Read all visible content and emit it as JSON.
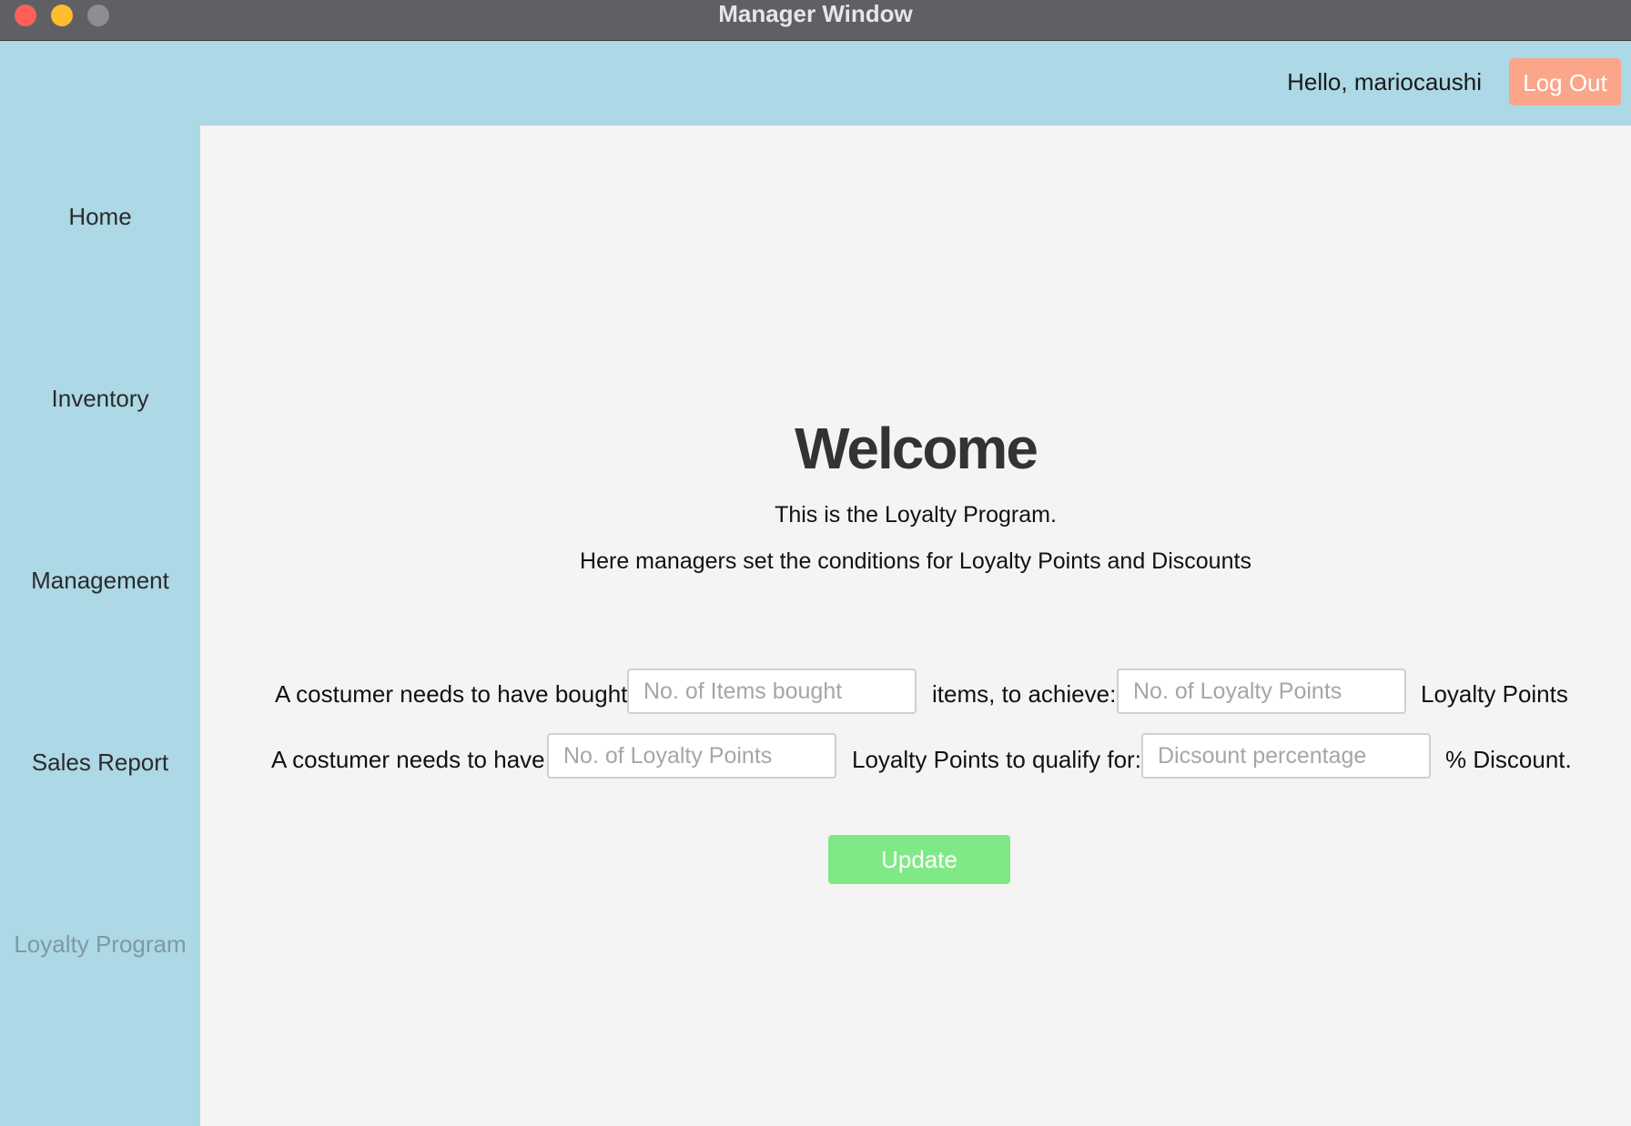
{
  "window": {
    "title": "Manager Window"
  },
  "header": {
    "greeting": "Hello, mariocaushi",
    "logout_label": "Log Out"
  },
  "sidebar": {
    "items": [
      {
        "label": "Home",
        "active": false
      },
      {
        "label": "Inventory",
        "active": false
      },
      {
        "label": "Management",
        "active": false
      },
      {
        "label": "Sales Report",
        "active": false
      },
      {
        "label": "Loyalty Program",
        "active": true
      }
    ]
  },
  "main": {
    "heading": "Welcome",
    "subtitle_1": "This is the Loyalty Program.",
    "subtitle_2": "Here managers set the conditions for Loyalty Points and Discounts",
    "row1": {
      "label_before": "A costumer needs to have bought:",
      "items_field": {
        "value": "",
        "placeholder": "No. of Items bought"
      },
      "label_middle": "items, to achieve:",
      "points_field": {
        "value": "",
        "placeholder": "No. of Loyalty Points"
      },
      "label_after": "Loyalty Points"
    },
    "row2": {
      "label_before": "A costumer needs to have:",
      "points_field": {
        "value": "",
        "placeholder": "No. of Loyalty Points"
      },
      "label_middle": "Loyalty Points to qualify for:",
      "discount_field": {
        "value": "",
        "placeholder": "Dicsount percentage"
      },
      "label_after": "% Discount."
    },
    "update_label": "Update"
  },
  "colors": {
    "sidebar_bg": "#add8e6",
    "content_bg": "#f4f4f4",
    "logout_bg": "#fba58a",
    "update_bg": "#7fea85",
    "active_nav_text": "#7c9aa4"
  }
}
